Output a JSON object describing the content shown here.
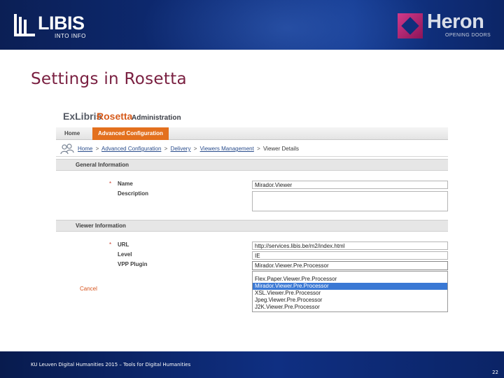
{
  "header": {
    "libis_logo": {
      "word": "LIBIS",
      "tagline": "INTO INFO"
    },
    "heron_logo": {
      "word": "Heron",
      "tagline": "OPENING DOORS"
    }
  },
  "slide": {
    "title": "Settings in Rosetta"
  },
  "rosetta": {
    "brand": {
      "exlibris": "ExLibris",
      "product": "Rosetta",
      "section": "Administration"
    },
    "nav": {
      "home": "Home",
      "advanced": "Advanced Configuration"
    },
    "breadcrumb": {
      "home": "Home",
      "advanced": "Advanced Configuration",
      "delivery": "Delivery",
      "viewers": "Viewers Management",
      "current": "Viewer Details",
      "separator": ">"
    },
    "general_section": "General Information",
    "viewer_section": "Viewer Information",
    "required_mark": "*",
    "fields": {
      "name_label": "Name",
      "name_value": "Mirador.Viewer",
      "description_label": "Description",
      "description_value": "",
      "url_label": "URL",
      "url_value": "http://services.libis.be/m2/index.html",
      "level_label": "Level",
      "level_value": "IE",
      "vpp_label": "VPP Plugin",
      "vpp_value": "Mirador.Viewer.Pre.Processor"
    },
    "vpp_options": [
      "Flex.Paper.Viewer.Pre.Processor",
      "Mirador.Viewer.Pre.Processor",
      "XSL.Viewer.Pre.Processor",
      "Jpeg.Viewer.Pre.Processor",
      "J2K.Viewer.Pre.Processor"
    ],
    "cancel_label": "Cancel"
  },
  "footer": {
    "text": "KU Leuven Digital Humanities 2015 – Tools for Digital Humanities",
    "page": "22"
  },
  "colors": {
    "title": "#7a2041",
    "accent_orange": "#e3701e",
    "selection": "#3a78d4",
    "band": "#0e2d7a"
  }
}
